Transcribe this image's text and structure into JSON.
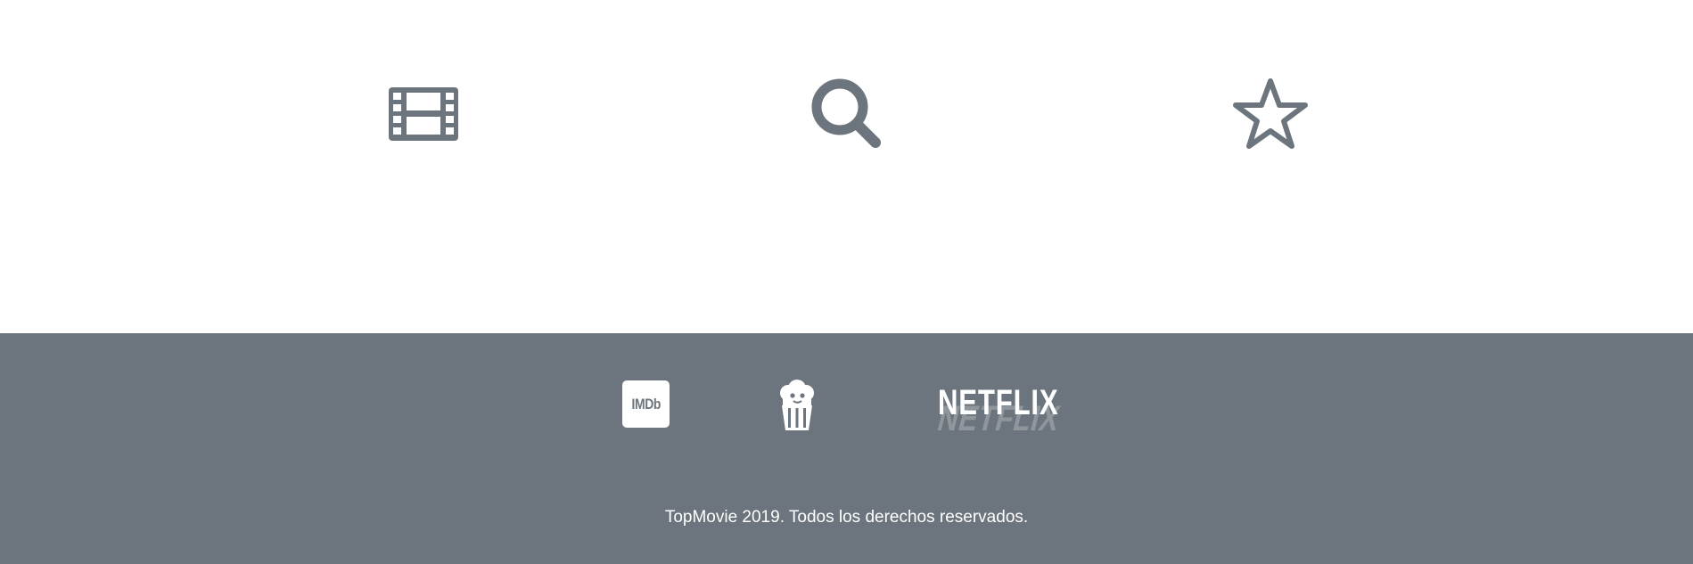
{
  "features": {
    "film_icon": "film-icon",
    "search_icon": "search-icon",
    "star_icon": "star-icon",
    "icon_color": "#6c757d"
  },
  "footer": {
    "background": "#6c757d",
    "partners": {
      "imdb_label": "IMDb",
      "popcorn_icon": "popcorn-icon",
      "netflix_label": "NETFLIX"
    },
    "copyright": "TopMovie 2019. Todos los derechos reservados."
  }
}
